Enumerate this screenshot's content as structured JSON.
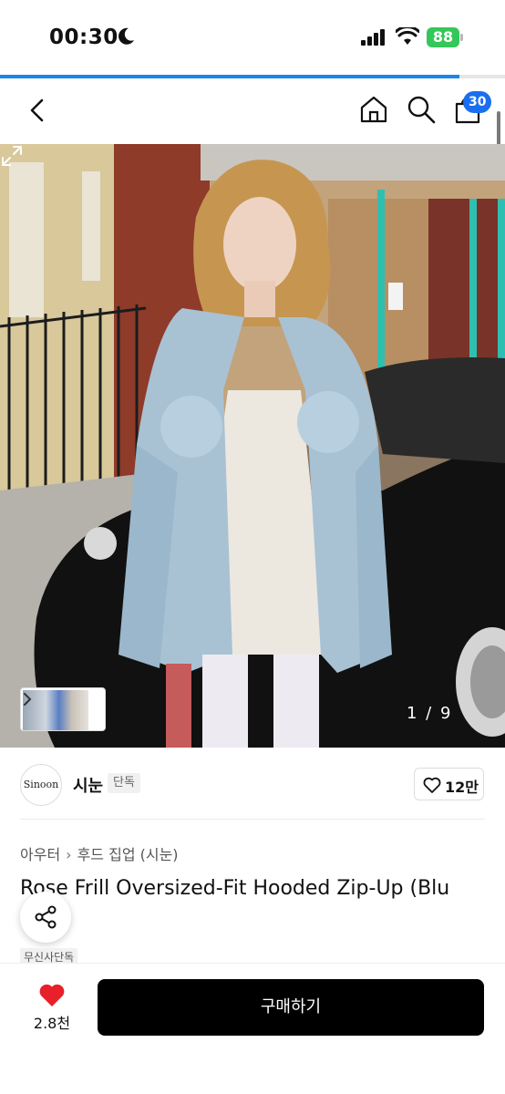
{
  "status_bar": {
    "time": "00:30",
    "battery": "88"
  },
  "load_progress": 0.91,
  "nav": {
    "cart_count": "30"
  },
  "gallery": {
    "counter": "1 / 9"
  },
  "brand": {
    "logo_text": "Sinoon",
    "name": "시눈",
    "tag": "단독",
    "like_count": "12만"
  },
  "product": {
    "breadcrumb": [
      "아우터",
      "후드 집업 (시눈)"
    ],
    "title": "Rose Frill Oversized-Fit Hooded Zip-Up (Blu",
    "exclusive_tag": "무신사단독"
  },
  "bottom": {
    "wish_count": "2.8천",
    "buy_label": "구매하기"
  },
  "colors": {
    "accent_blue": "#1a84f0",
    "cart_badge": "#1a6ef0",
    "heart_red": "#e8202a",
    "battery_green": "#34c759"
  }
}
